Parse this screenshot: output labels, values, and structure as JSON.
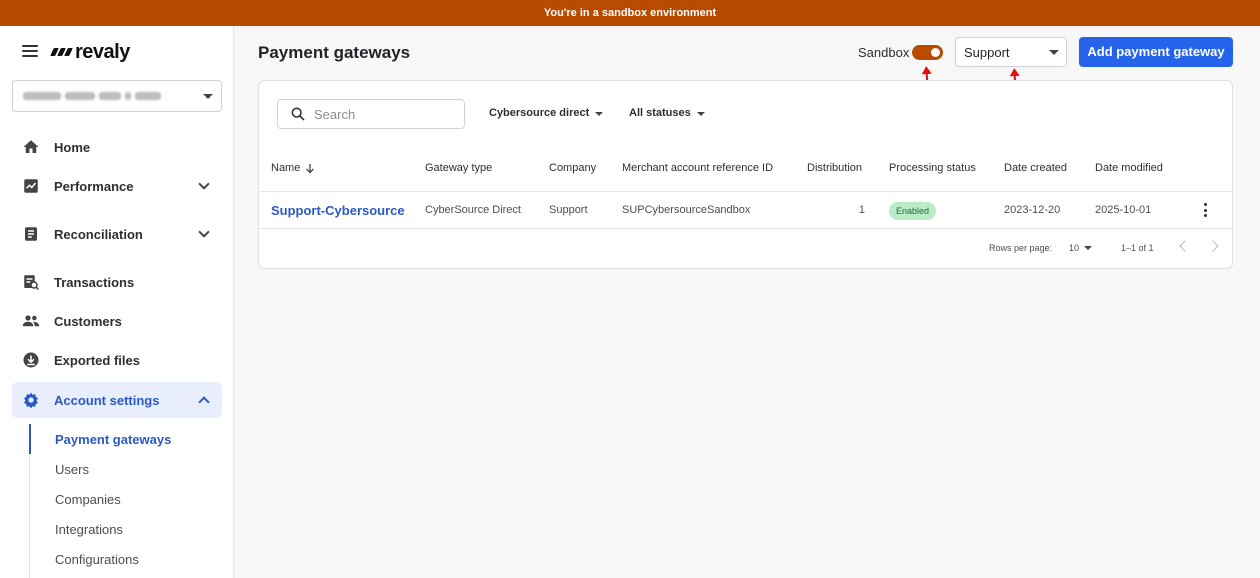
{
  "banner": {
    "text": "You're in a sandbox environment"
  },
  "app": {
    "logo_text": "revaly"
  },
  "sidebar": {
    "items": [
      {
        "label": "Home",
        "icon": "home-icon"
      },
      {
        "label": "Performance",
        "icon": "chart-icon"
      },
      {
        "label": "Reconciliation",
        "icon": "document-icon"
      },
      {
        "label": "Transactions",
        "icon": "receipt-search-icon"
      },
      {
        "label": "Customers",
        "icon": "people-icon"
      },
      {
        "label": "Exported files",
        "icon": "download-icon"
      },
      {
        "label": "Account settings",
        "icon": "gear-icon"
      }
    ],
    "subitems": [
      {
        "label": "Payment gateways"
      },
      {
        "label": "Users"
      },
      {
        "label": "Companies"
      },
      {
        "label": "Integrations"
      },
      {
        "label": "Configurations"
      }
    ]
  },
  "header": {
    "title": "Payment gateways",
    "sandbox_label": "Sandbox",
    "sandbox_enabled": true,
    "company_value": "Support",
    "add_button_label": "Add payment gateway"
  },
  "filters": {
    "search_placeholder": "Search",
    "gateway_filter": "Cybersource direct",
    "status_filter": "All statuses"
  },
  "table": {
    "columns": [
      "Name",
      "Gateway type",
      "Company",
      "Merchant account reference ID",
      "Distribution",
      "Processing status",
      "Date created",
      "Date modified"
    ],
    "rows": [
      {
        "name": "Support-Cybersource",
        "gateway_type": "CyberSource Direct",
        "company": "Support",
        "merchant_ref": "SUPCybersourceSandbox",
        "distribution": "1",
        "status": "Enabled",
        "date_created": "2023-12-20",
        "date_modified": "2025-10-01"
      }
    ]
  },
  "pagination": {
    "rows_per_page_label": "Rows per page:",
    "rows_per_page": "10",
    "range": "1–1 of 1"
  },
  "colors": {
    "banner": "#b84b00",
    "accent": "#2563eb",
    "link": "#2b59c3",
    "status_enabled_bg": "#b9ecc7",
    "annotation_arrow": "#e01010"
  }
}
